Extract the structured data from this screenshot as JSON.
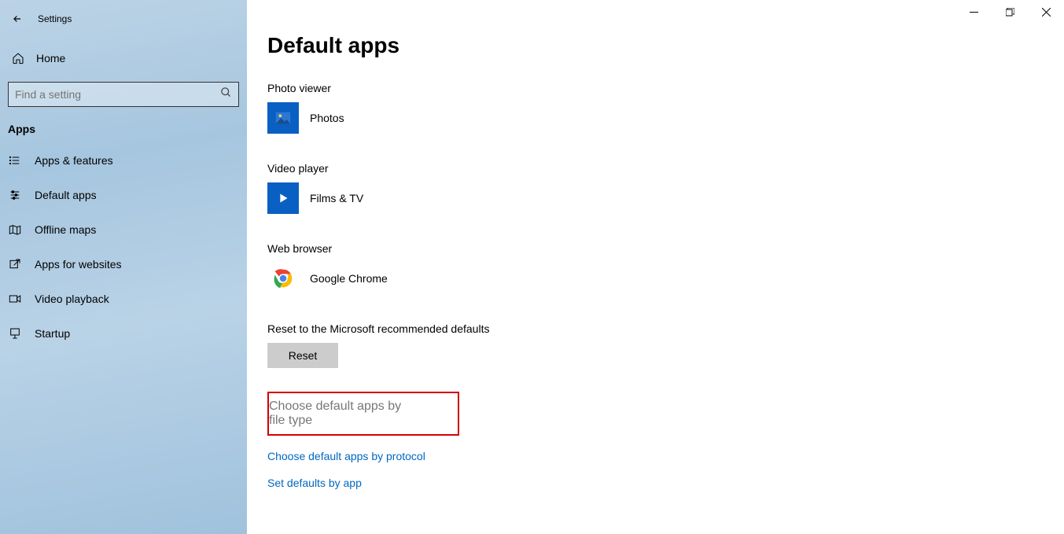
{
  "window": {
    "title": "Settings"
  },
  "controls": {
    "minimize": "–",
    "maximize": "❐",
    "close": "✕"
  },
  "sidebar": {
    "home": "Home",
    "search_placeholder": "Find a setting",
    "section": "Apps",
    "items": [
      "Apps & features",
      "Default apps",
      "Offline maps",
      "Apps for websites",
      "Video playback",
      "Startup"
    ]
  },
  "main": {
    "title": "Default apps",
    "sections": [
      {
        "label": "Photo viewer",
        "app": "Photos"
      },
      {
        "label": "Video player",
        "app": "Films & TV"
      },
      {
        "label": "Web browser",
        "app": "Google Chrome"
      }
    ],
    "reset_label": "Reset to the Microsoft recommended defaults",
    "reset_button": "Reset",
    "links": {
      "by_file_type": "Choose default apps by file type",
      "by_protocol": "Choose default apps by protocol",
      "by_app": "Set defaults by app"
    }
  }
}
